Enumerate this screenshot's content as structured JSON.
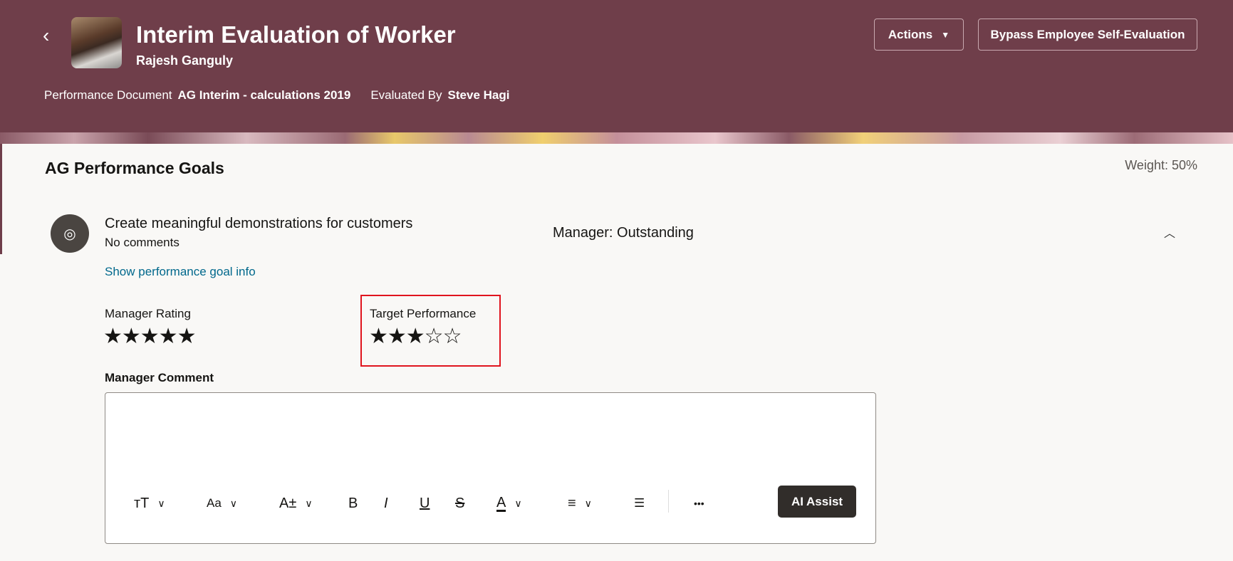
{
  "header": {
    "title": "Interim Evaluation of Worker",
    "worker_name": "Rajesh Ganguly",
    "doc_label": "Performance Document",
    "doc_value": "AG Interim - calculations 2019",
    "eval_label": "Evaluated By",
    "eval_value": "Steve Hagi",
    "actions_label": "Actions",
    "bypass_label": "Bypass Employee Self-Evaluation",
    "back": "‹"
  },
  "section": {
    "title": "AG Performance Goals",
    "weight": "Weight: 50%"
  },
  "goal": {
    "title": "Create meaningful demonstrations for customers",
    "comments": "No comments",
    "manager_status": "Manager: Outstanding",
    "info_link": "Show performance goal info",
    "manager_rating_label": "Manager Rating",
    "manager_rating": 5,
    "manager_rating_stars": "★★★★★",
    "target_label": "Target Performance",
    "target_rating": 3,
    "target_rating_stars": "★★★☆☆",
    "max_rating": 5
  },
  "editor": {
    "label": "Manager Comment",
    "value": "",
    "ai_label": "AI Assist",
    "tools": {
      "size": "тT",
      "font": "Aa",
      "script": "A±",
      "bold": "B",
      "italic": "I",
      "underline": "U",
      "strike": "S",
      "color": "A",
      "align": "≡",
      "list": "☰",
      "more": "•••",
      "chev": "⌄"
    }
  },
  "colors": {
    "header": "#6f3e4a",
    "link": "#00688c",
    "highlight": "#e0141e"
  }
}
